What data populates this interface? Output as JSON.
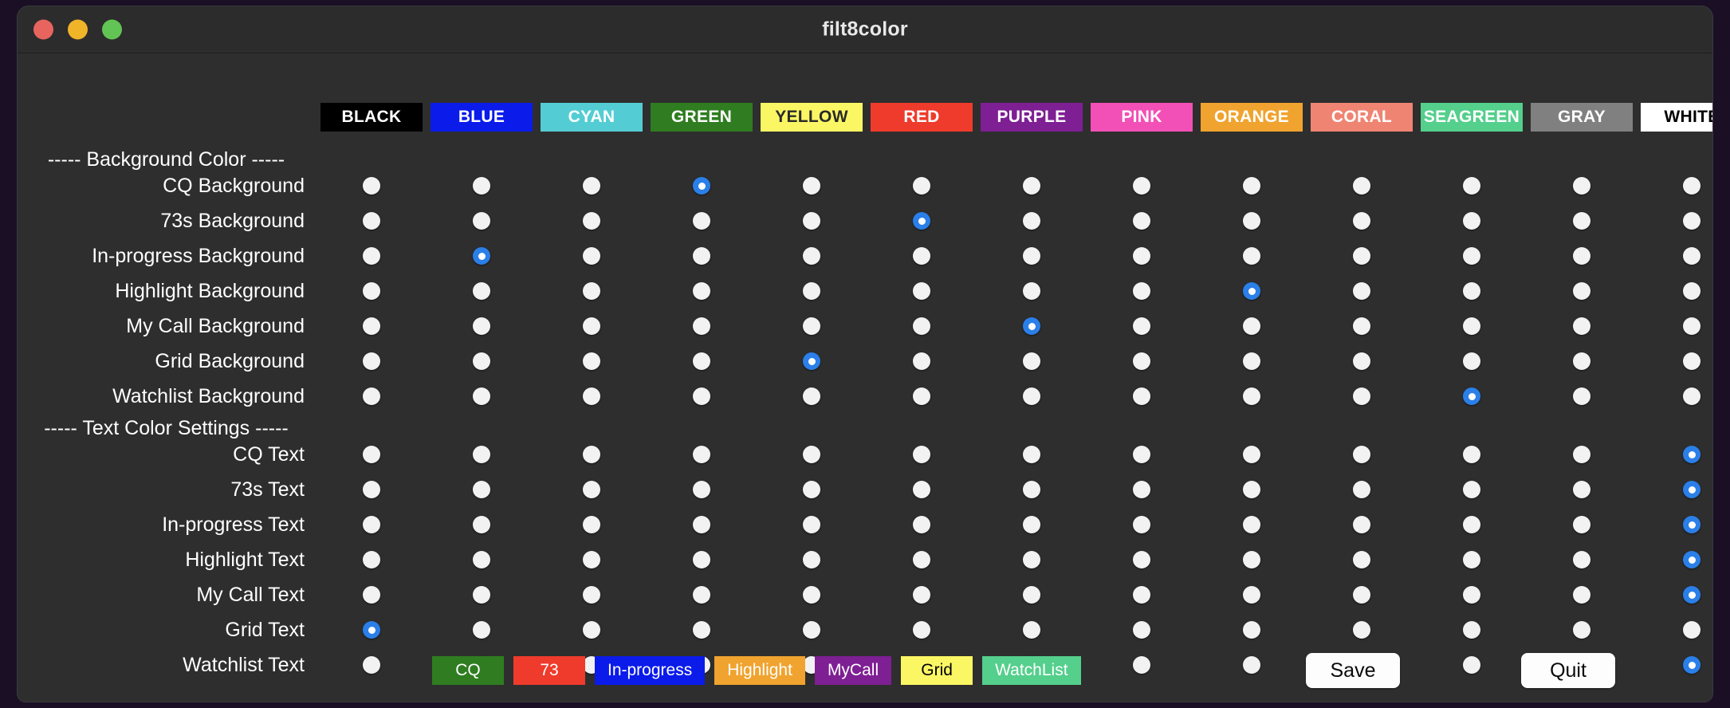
{
  "window": {
    "title": "filt8color",
    "traffic_lights": [
      "close-button",
      "minimize-button",
      "maximize-button"
    ]
  },
  "columns": [
    {
      "label": "BLACK",
      "bg": "#000000",
      "fg": "#ffffff"
    },
    {
      "label": "BLUE",
      "bg": "#0a1bea",
      "fg": "#ffffff"
    },
    {
      "label": "CYAN",
      "bg": "#53cdd3",
      "fg": "#ffffff"
    },
    {
      "label": "GREEN",
      "bg": "#2f7d20",
      "fg": "#ffffff"
    },
    {
      "label": "YELLOW",
      "bg": "#fbf764",
      "fg": "#2a2a2a"
    },
    {
      "label": "RED",
      "bg": "#ef3b2c",
      "fg": "#ffffff"
    },
    {
      "label": "PURPLE",
      "bg": "#7e1f93",
      "fg": "#ffffff"
    },
    {
      "label": "PINK",
      "bg": "#f250b6",
      "fg": "#ffffff"
    },
    {
      "label": "ORANGE",
      "bg": "#f0a32e",
      "fg": "#ffffff"
    },
    {
      "label": "CORAL",
      "bg": "#ef8472",
      "fg": "#ffffff"
    },
    {
      "label": "SEAGREEN",
      "bg": "#54cf8c",
      "fg": "#ffffff"
    },
    {
      "label": "GRAY",
      "bg": "#808080",
      "fg": "#ffffff"
    },
    {
      "label": "WHITE",
      "bg": "#ffffff",
      "fg": "#000000"
    }
  ],
  "sections": [
    {
      "heading": "----- Background Color -----",
      "rows": [
        {
          "label": "CQ Background",
          "selected": 3
        },
        {
          "label": "73s Background",
          "selected": 5
        },
        {
          "label": "In-progress Background",
          "selected": 1
        },
        {
          "label": "Highlight Background",
          "selected": 8
        },
        {
          "label": "My Call Background",
          "selected": 6
        },
        {
          "label": "Grid Background",
          "selected": 4
        },
        {
          "label": "Watchlist Background",
          "selected": 10
        }
      ]
    },
    {
      "heading": "----- Text Color Settings -----",
      "rows": [
        {
          "label": "CQ Text",
          "selected": 12
        },
        {
          "label": "73s Text",
          "selected": 12
        },
        {
          "label": "In-progress Text",
          "selected": 12
        },
        {
          "label": "Highlight Text",
          "selected": 12
        },
        {
          "label": "My Call Text",
          "selected": 12
        },
        {
          "label": "Grid Text",
          "selected": 0
        },
        {
          "label": "Watchlist Text",
          "selected": 12
        }
      ]
    }
  ],
  "preview_buttons": [
    {
      "label": "CQ",
      "bg": "#2f7d20",
      "fg": "#ffffff"
    },
    {
      "label": "73",
      "bg": "#ef3b2c",
      "fg": "#ffffff"
    },
    {
      "label": "In-progress",
      "bg": "#0a1bea",
      "fg": "#ffffff"
    },
    {
      "label": "Highlight",
      "bg": "#f0a32e",
      "fg": "#ffffff"
    },
    {
      "label": "MyCall",
      "bg": "#7e1f93",
      "fg": "#ffffff"
    },
    {
      "label": "Grid",
      "bg": "#fbf764",
      "fg": "#000000"
    },
    {
      "label": "WatchList",
      "bg": "#54cf8c",
      "fg": "#ffffff"
    }
  ],
  "actions": {
    "save_label": "Save",
    "quit_label": "Quit"
  },
  "theme": {
    "window_bg": "#2e2e2e",
    "titlebar_bg": "#2c2c2c",
    "accent_selected": "#2b7fe8",
    "radio_off": "#f2f2f2",
    "text": "#ffffff"
  }
}
